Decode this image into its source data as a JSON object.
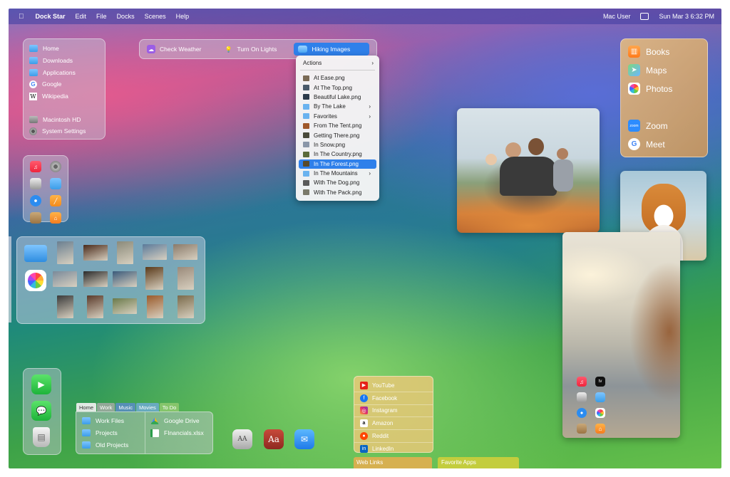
{
  "menubar": {
    "apple": "",
    "app": "Dock Star",
    "items": [
      "Edit",
      "File",
      "Docks",
      "Scenes",
      "Help"
    ],
    "user": "Mac User",
    "datetime": "Sun Mar 3  6:32 PM"
  },
  "favorites": [
    "Home",
    "Downloads",
    "Applications",
    "Google",
    "Wikipedia",
    "Macintosh HD",
    "System Settings"
  ],
  "scenes": [
    "Check Weather",
    "Turn On Lights",
    "Hiking Images"
  ],
  "hiking_menu": {
    "header": "Actions",
    "items": [
      "At Ease.png",
      "At The Top.png",
      "Beautiful Lake.png",
      "By The Lake",
      "Favorites",
      "From The Tent.png",
      "Getting There.png",
      "In Snow.png",
      "In The Country.png",
      "In The Forest.png",
      "In The Mountains",
      "With The Dog.png",
      "With The Pack.png"
    ],
    "selected": "In The Forest.png"
  },
  "right_apps": [
    "Books",
    "Maps",
    "Photos",
    "Zoom",
    "Meet"
  ],
  "finder_tabs": [
    "Home",
    "Work",
    "Music",
    "Movies",
    "To Do"
  ],
  "finder_files": [
    "Work Files",
    "Projects",
    "Old Projects",
    "Google Drive",
    "FInancials.xlsx"
  ],
  "web_links": [
    "YouTube",
    "Facebook",
    "Instagram",
    "Amazon",
    "Reddit",
    "LinkedIn"
  ],
  "dock_labels": [
    "Web Links",
    "Favorite Apps"
  ],
  "glyphs": {
    "zoom": "zoom",
    "g": "G",
    "w": "W",
    "dict": "Aa",
    "fontbook": "AA"
  }
}
